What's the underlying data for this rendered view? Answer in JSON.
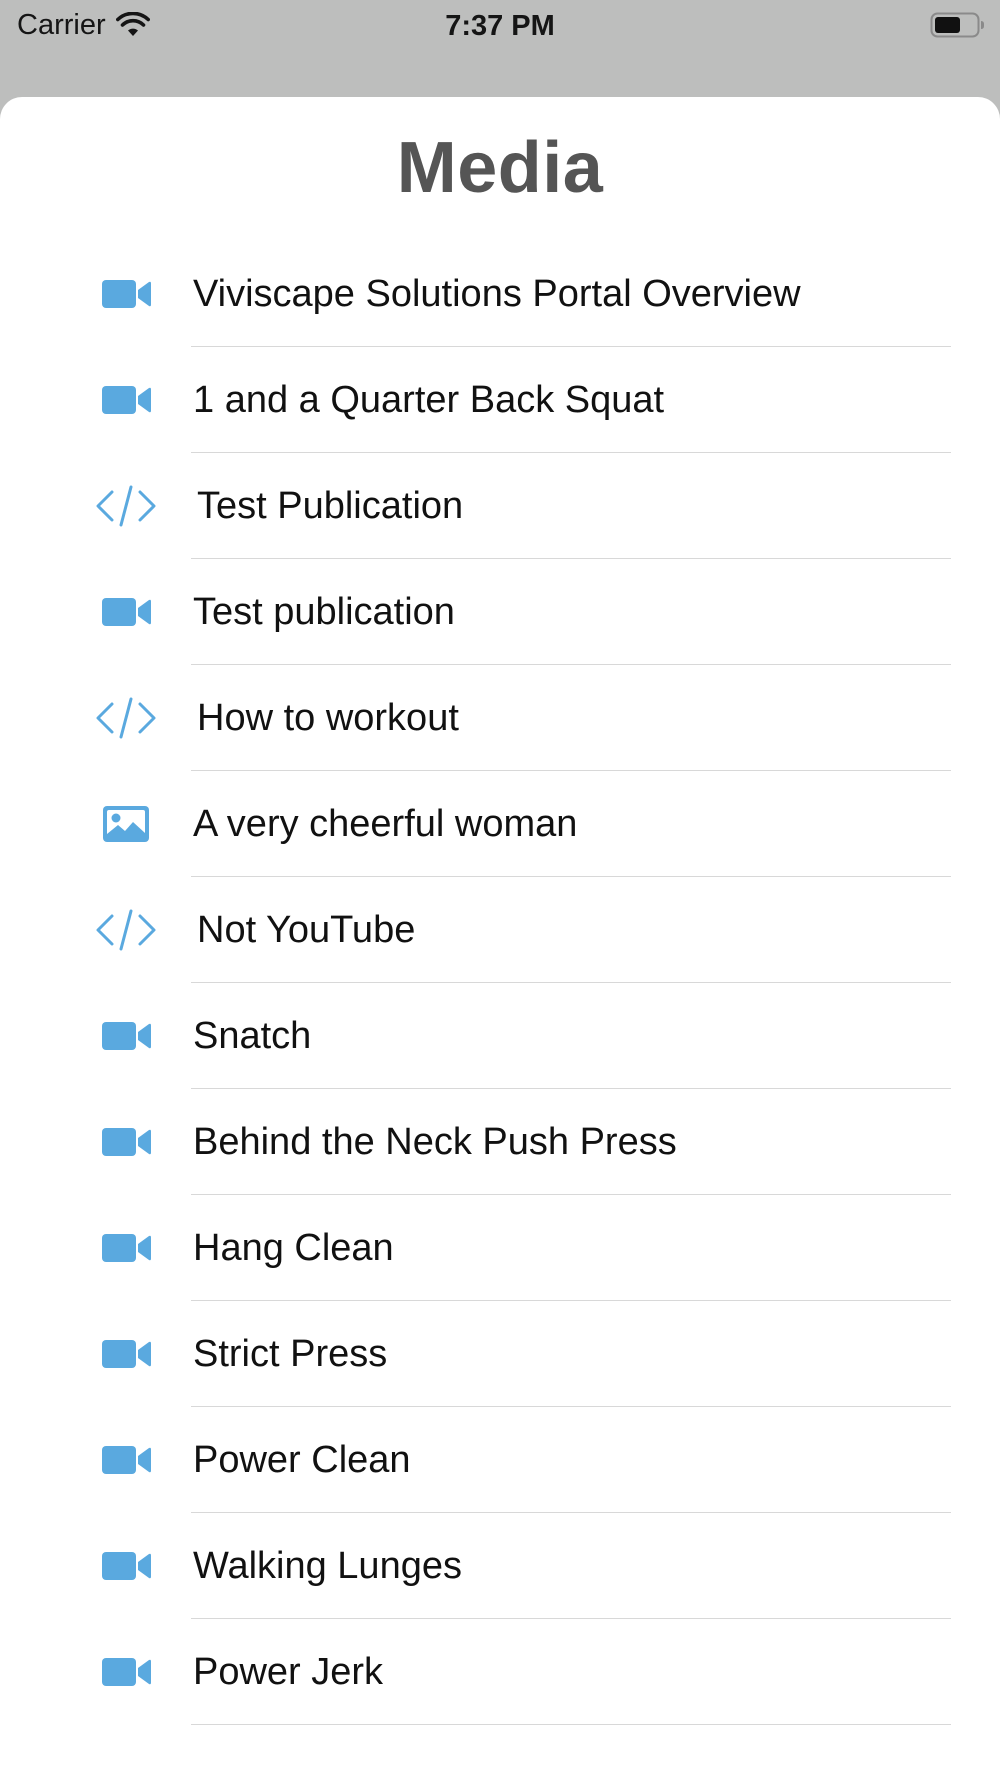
{
  "status_bar": {
    "carrier": "Carrier",
    "time": "7:37 PM",
    "icons": [
      "wifi-icon",
      "battery-icon"
    ]
  },
  "page": {
    "title": "Media"
  },
  "colors": {
    "icon_blue": "#5aa9df",
    "title_gray": "#555555",
    "divider": "#d8d8d8",
    "background_dim": "#bdbebd"
  },
  "media_items": [
    {
      "label": "Viviscape Solutions Portal Overview",
      "icon": "video-camera-icon"
    },
    {
      "label": "1 and a Quarter Back Squat",
      "icon": "video-camera-icon"
    },
    {
      "label": "Test Publication",
      "icon": "code-icon"
    },
    {
      "label": "Test publication",
      "icon": "video-camera-icon"
    },
    {
      "label": "How to workout",
      "icon": "code-icon"
    },
    {
      "label": "A very cheerful woman",
      "icon": "image-icon"
    },
    {
      "label": "Not YouTube",
      "icon": "code-icon"
    },
    {
      "label": "Snatch",
      "icon": "video-camera-icon"
    },
    {
      "label": "Behind the Neck Push Press",
      "icon": "video-camera-icon"
    },
    {
      "label": "Hang Clean",
      "icon": "video-camera-icon"
    },
    {
      "label": "Strict Press",
      "icon": "video-camera-icon"
    },
    {
      "label": "Power Clean",
      "icon": "video-camera-icon"
    },
    {
      "label": "Walking Lunges",
      "icon": "video-camera-icon"
    },
    {
      "label": "Power Jerk",
      "icon": "video-camera-icon"
    }
  ]
}
